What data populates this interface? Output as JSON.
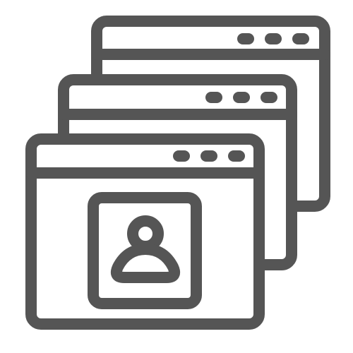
{
  "icon": {
    "name": "multiple-browser-windows-user-profile-icon",
    "stroke_color": "#555555",
    "background_color": "#ffffff",
    "window_count": 3,
    "window_controls_per_window": 3,
    "content_icon": "user-profile-icon"
  }
}
